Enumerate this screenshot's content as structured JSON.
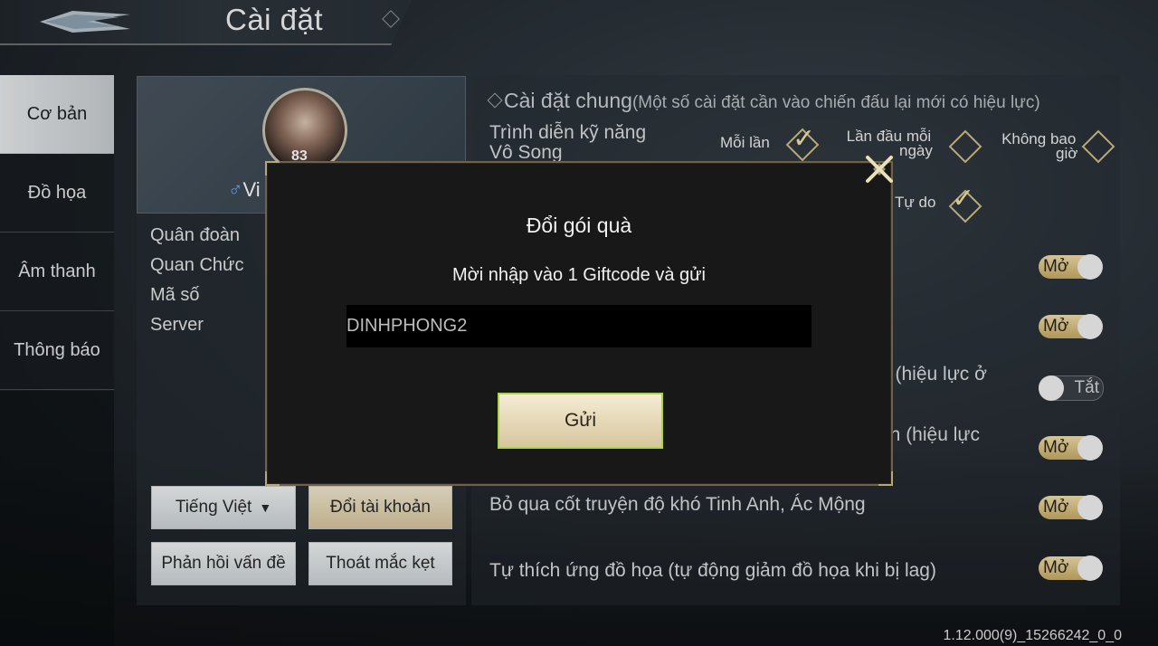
{
  "header": {
    "title": "Cài đặt"
  },
  "sidenav": {
    "items": [
      {
        "label": "Cơ bản"
      },
      {
        "label": "Đồ họa"
      },
      {
        "label": "Âm thanh"
      },
      {
        "label": "Thông báo"
      }
    ]
  },
  "profile": {
    "level": "83",
    "gender_symbol": "♂",
    "name": "Vi",
    "labels": [
      "Quân đoàn",
      "Quan Chức",
      "Mã số",
      "Server"
    ]
  },
  "left_buttons": {
    "language": "Tiếng Việt",
    "switch_account": "Đổi tài khoản",
    "feedback": "Phản hồi vấn đề",
    "unstuck": "Thoát mắc kẹt"
  },
  "settings": {
    "section_title": "Cài đặt chung",
    "section_note": "(Một số cài đặt cần vào chiến đấu lại mới có hiệu lực)",
    "skill_display": {
      "label_line1": "Trình diễn kỹ năng",
      "label_line2": "Vô Song",
      "opt_each_time": "Mỗi lần",
      "opt_first_daily_1": "Lần đầu mỗi",
      "opt_first_daily_2": "ngày",
      "opt_never_1": "Không bao",
      "opt_never_2": "giờ",
      "opt_free": "Tự do"
    },
    "rows": [
      {
        "text": "",
        "state": "Mở"
      },
      {
        "text": "",
        "state": "Mở"
      },
      {
        "text": "n (hiệu lực ở",
        "state": "Tắt"
      },
      {
        "text": "nh (hiệu lực",
        "state": "Mở"
      },
      {
        "text": "Bỏ qua cốt truyện độ khó Tinh Anh, Ác Mộng",
        "state": "Mở"
      },
      {
        "text": "Tự thích ứng đồ họa (tự động giảm đồ họa khi bị lag)",
        "state": "Mở"
      }
    ]
  },
  "version": "1.12.000(9)_15266242_0_0",
  "modal": {
    "title": "Đổi gói quà",
    "subtitle": "Mời nhập vào 1 Giftcode và gửi",
    "input_value": "DINHPHONG2",
    "send_label": "Gửi"
  },
  "colors": {
    "gold": "#d9c8a0",
    "accent_border": "#a6d64c",
    "modal_bg": "#181818"
  }
}
